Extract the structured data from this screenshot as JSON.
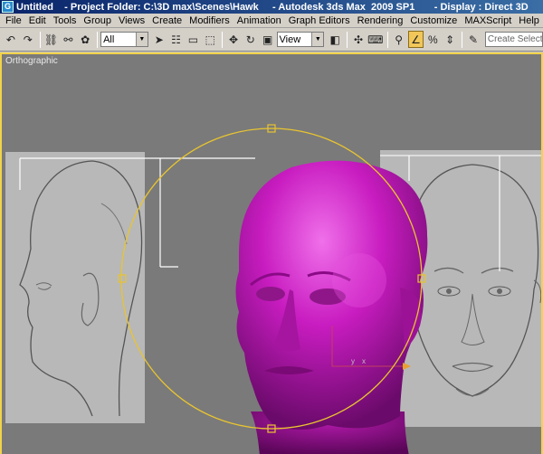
{
  "window": {
    "title": "Untitled    - Project Folder: C:\\3D max\\Scenes\\Hawk     - Autodesk 3ds Max  2009 SP1       - Display : Direct 3D",
    "icon_glyph": "G"
  },
  "menu": [
    "File",
    "Edit",
    "Tools",
    "Group",
    "Views",
    "Create",
    "Modifiers",
    "Animation",
    "Graph Editors",
    "Rendering",
    "Customize",
    "MAXScript",
    "Help"
  ],
  "toolbar": {
    "selection_filter": "All",
    "reference_coord": "View",
    "named_selection_placeholder": "Create Selection S"
  },
  "viewport": {
    "label": "Orthographic",
    "gizmo_axis_y": "y",
    "gizmo_axis_x": "x"
  },
  "colors": {
    "viewport_bg": "#7a7a7a",
    "head_mesh": "#c81cc0",
    "gizmo": "#e8c430"
  }
}
